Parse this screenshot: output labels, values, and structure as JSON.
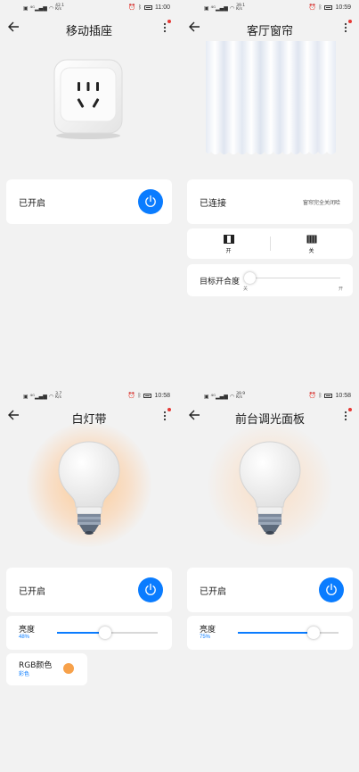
{
  "colors": {
    "accent": "#0a7cff",
    "background": "#f2f2f2",
    "card": "#ffffff",
    "alert_dot": "#e53935"
  },
  "panels": {
    "socket": {
      "status_bar": {
        "net_speed": "42.1\nK/s",
        "time": "11:00"
      },
      "title": "移动插座",
      "status_label": "已开启",
      "device_icon": "power-socket-icon"
    },
    "curtain": {
      "status_bar": {
        "net_speed": "39.1\nK/s",
        "time": "10:59"
      },
      "title": "客厅窗帘",
      "status_label": "已连接",
      "status_hint": "窗帘完全关闭哈",
      "open_label": "开",
      "close_label": "关",
      "target_label": "目标开合度",
      "target_min": "关",
      "target_max": "开",
      "target_value": 0
    },
    "light_strip": {
      "status_bar": {
        "net_speed": "3.7\nK/s",
        "time": "10:58"
      },
      "title": "白灯带",
      "status_label": "已开启",
      "brightness_label": "亮度",
      "brightness_value": "48%",
      "brightness_percent": 48,
      "rgb_label": "RGB颜色",
      "rgb_value": "彩色",
      "rgb_color": "#f7a14a"
    },
    "dimmer": {
      "status_bar": {
        "net_speed": "39.9\nK/s",
        "time": "10:58"
      },
      "title": "前台调光面板",
      "status_label": "已开启",
      "brightness_label": "亮度",
      "brightness_value": "75%",
      "brightness_percent": 75
    }
  }
}
